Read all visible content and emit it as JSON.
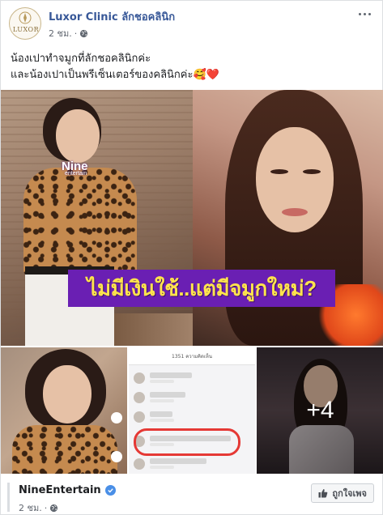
{
  "post": {
    "page_name": "Luxor Clinic ลักชอคลินิก",
    "avatar_text": "LUXOR",
    "timestamp": "2 ชม.",
    "separator": "·",
    "caption_lines": [
      "น้องเปาทำจมูกที่ลักชอคลินิกค่ะ",
      "และน้องเปาเป็นพรีเซ็นเตอร์ของคลินิกค่ะ🥰❤️"
    ]
  },
  "photos": {
    "brand_tag": "Nine",
    "brand_tag_sub": "entertain",
    "headline": "ไม่มีเงินใช้..แต่มีจมูกใหม่?",
    "comment_header": "1351 ความคิดเห็น",
    "more_count": "+4"
  },
  "shared_from": {
    "name": "NineEntertain",
    "timestamp": "2 ชม.",
    "separator": "·",
    "like_page_label": "ถูกใจเพจ"
  },
  "colors": {
    "link_blue": "#385898",
    "headline_bg": "#6a1fb3",
    "headline_text": "#ffe34d",
    "highlight_red": "#e53935"
  }
}
